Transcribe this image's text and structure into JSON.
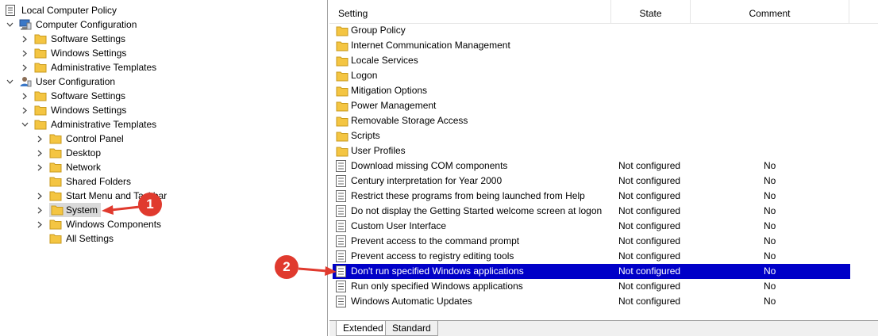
{
  "tree": {
    "root": "Local Computer Policy",
    "computer_config": "Computer Configuration",
    "cc_software": "Software Settings",
    "cc_windows": "Windows Settings",
    "cc_admin": "Administrative Templates",
    "user_config": "User Configuration",
    "uc_software": "Software Settings",
    "uc_windows": "Windows Settings",
    "uc_admin": "Administrative Templates",
    "admin_children": [
      "Control Panel",
      "Desktop",
      "Network",
      "Shared Folders",
      "Start Menu and Taskbar",
      "System",
      "Windows Components",
      "All Settings"
    ],
    "selected": "System"
  },
  "columns": {
    "setting": "Setting",
    "state": "State",
    "comment": "Comment"
  },
  "folders": [
    "Group Policy",
    "Internet Communication Management",
    "Locale Services",
    "Logon",
    "Mitigation Options",
    "Power Management",
    "Removable Storage Access",
    "Scripts",
    "User Profiles"
  ],
  "policies": [
    {
      "name": "Download missing COM components",
      "state": "Not configured",
      "comment": "No"
    },
    {
      "name": "Century interpretation for Year 2000",
      "state": "Not configured",
      "comment": "No"
    },
    {
      "name": "Restrict these programs from being launched from Help",
      "state": "Not configured",
      "comment": "No"
    },
    {
      "name": "Do not display the Getting Started welcome screen at logon",
      "state": "Not configured",
      "comment": "No"
    },
    {
      "name": "Custom User Interface",
      "state": "Not configured",
      "comment": "No"
    },
    {
      "name": "Prevent access to the command prompt",
      "state": "Not configured",
      "comment": "No"
    },
    {
      "name": "Prevent access to registry editing tools",
      "state": "Not configured",
      "comment": "No"
    },
    {
      "name": "Don't run specified Windows applications",
      "state": "Not configured",
      "comment": "No"
    },
    {
      "name": "Run only specified Windows applications",
      "state": "Not configured",
      "comment": "No"
    },
    {
      "name": "Windows Automatic Updates",
      "state": "Not configured",
      "comment": "No"
    }
  ],
  "selected_policy_index": 7,
  "tabs": {
    "extended": "Extended",
    "standard": "Standard"
  },
  "callouts": {
    "one": "1",
    "two": "2"
  },
  "colors": {
    "selection": "#0000c8",
    "callout": "#e03a2e",
    "folder": "#f4c542"
  }
}
